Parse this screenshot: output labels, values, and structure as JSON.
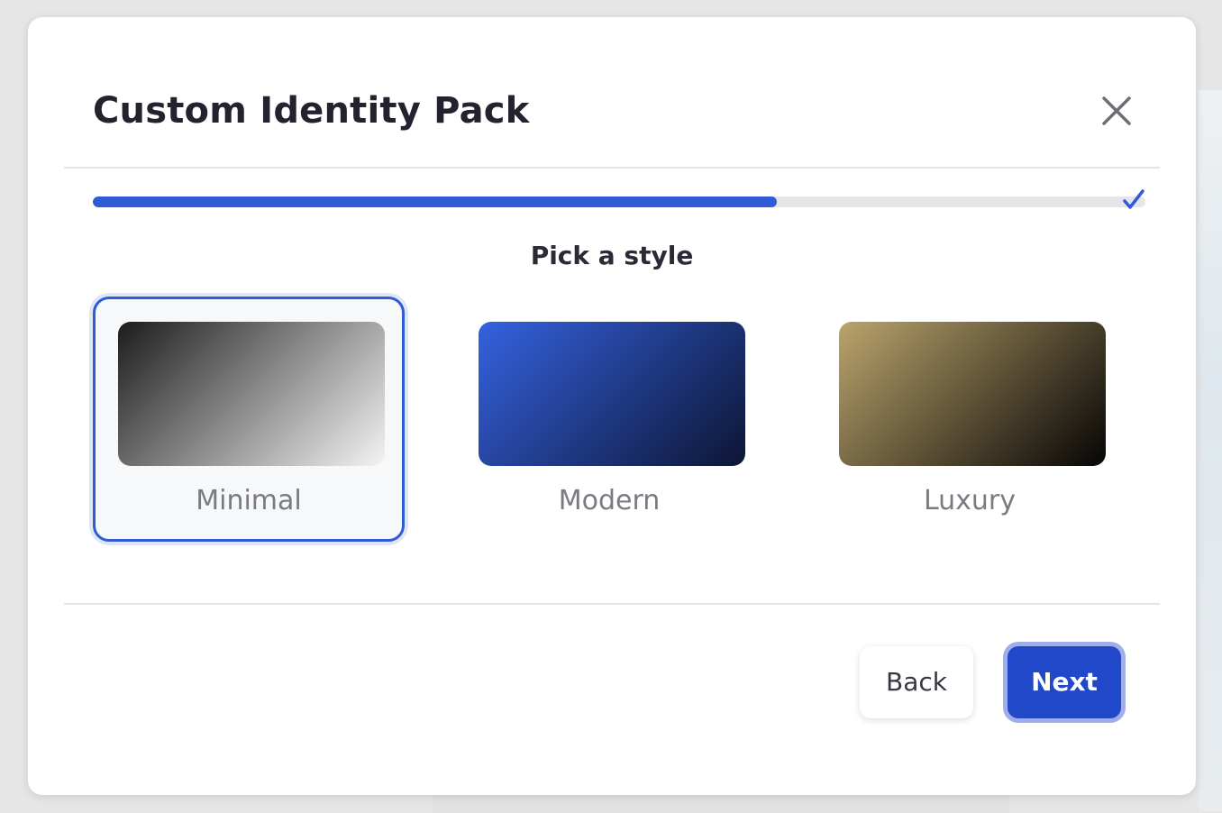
{
  "modal": {
    "title": "Custom Identity Pack"
  },
  "progress": {
    "percent": 65,
    "complete_icon": "check-icon"
  },
  "step": {
    "title": "Pick a style"
  },
  "styles": [
    {
      "label": "Minimal",
      "selected": true,
      "gradient": [
        "#1c1c1c",
        "#f4f4f4"
      ]
    },
    {
      "label": "Modern",
      "selected": false,
      "gradient": [
        "#3462e0",
        "#0d1534"
      ]
    },
    {
      "label": "Luxury",
      "selected": false,
      "gradient": [
        "#bba46c",
        "#060505"
      ]
    }
  ],
  "footer": {
    "back_label": "Back",
    "next_label": "Next"
  },
  "colors": {
    "accent": "#2f5bd6",
    "primary_button": "#2148c9"
  }
}
